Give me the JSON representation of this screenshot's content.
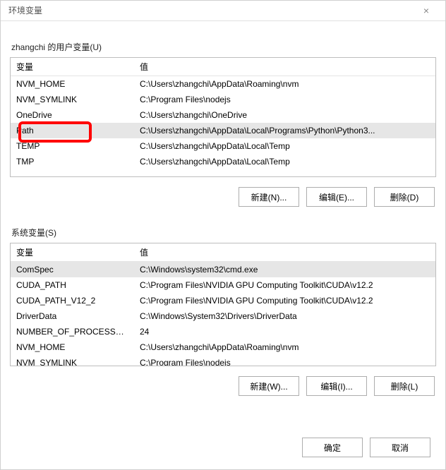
{
  "window": {
    "title": "环境变量",
    "close_glyph": "×"
  },
  "user_section": {
    "label": "zhangchi 的用户变量(U)",
    "col_name": "变量",
    "col_value": "值",
    "rows": [
      {
        "name": "NVM_HOME",
        "value": "C:\\Users\\zhangchi\\AppData\\Roaming\\nvm",
        "selected": false
      },
      {
        "name": "NVM_SYMLINK",
        "value": "C:\\Program Files\\nodejs",
        "selected": false
      },
      {
        "name": "OneDrive",
        "value": "C:\\Users\\zhangchi\\OneDrive",
        "selected": false
      },
      {
        "name": "Path",
        "value": "C:\\Users\\zhangchi\\AppData\\Local\\Programs\\Python\\Python3...",
        "selected": true
      },
      {
        "name": "TEMP",
        "value": "C:\\Users\\zhangchi\\AppData\\Local\\Temp",
        "selected": false
      },
      {
        "name": "TMP",
        "value": "C:\\Users\\zhangchi\\AppData\\Local\\Temp",
        "selected": false
      }
    ],
    "buttons": {
      "new": "新建(N)...",
      "edit": "编辑(E)...",
      "del": "删除(D)"
    }
  },
  "system_section": {
    "label": "系统变量(S)",
    "col_name": "变量",
    "col_value": "值",
    "rows": [
      {
        "name": "ComSpec",
        "value": "C:\\Windows\\system32\\cmd.exe",
        "selected": true
      },
      {
        "name": "CUDA_PATH",
        "value": "C:\\Program Files\\NVIDIA GPU Computing Toolkit\\CUDA\\v12.2",
        "selected": false
      },
      {
        "name": "CUDA_PATH_V12_2",
        "value": "C:\\Program Files\\NVIDIA GPU Computing Toolkit\\CUDA\\v12.2",
        "selected": false
      },
      {
        "name": "DriverData",
        "value": "C:\\Windows\\System32\\Drivers\\DriverData",
        "selected": false
      },
      {
        "name": "NUMBER_OF_PROCESSORS",
        "value": "24",
        "selected": false
      },
      {
        "name": "NVM_HOME",
        "value": "C:\\Users\\zhangchi\\AppData\\Roaming\\nvm",
        "selected": false
      },
      {
        "name": "NVM_SYMLINK",
        "value": "C:\\Program Files\\nodejs",
        "selected": false
      }
    ],
    "buttons": {
      "new": "新建(W)...",
      "edit": "编辑(I)...",
      "del": "删除(L)"
    }
  },
  "dialog_buttons": {
    "ok": "确定",
    "cancel": "取消"
  }
}
